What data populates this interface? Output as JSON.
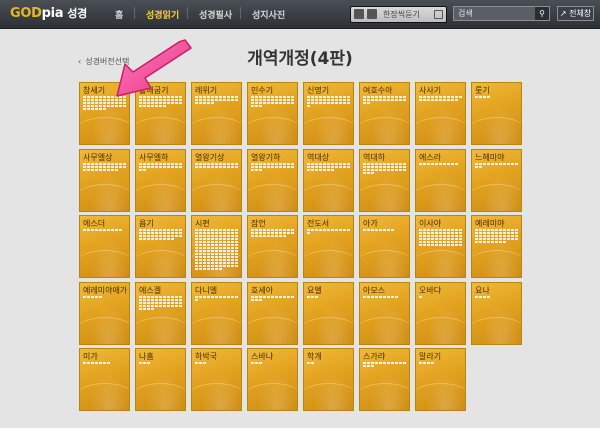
{
  "header": {
    "logo_go": "GOD",
    "logo_pia": "pia",
    "logo_sub": "성경",
    "nav": [
      "홈",
      "성경읽기",
      "성경필사",
      "성지사진"
    ],
    "active_nav_index": 1,
    "tts_label": "한장씩듣기",
    "search_placeholder": "검색",
    "fullscreen_label": "전체창"
  },
  "back_link": "성경버전선택",
  "page_title": "개역개정(4판)",
  "books": [
    {
      "name": "창세기",
      "chapters": 50
    },
    {
      "name": "출애굽기",
      "chapters": 40
    },
    {
      "name": "레위기",
      "chapters": 27
    },
    {
      "name": "민수기",
      "chapters": 36
    },
    {
      "name": "신명기",
      "chapters": 34
    },
    {
      "name": "여호수아",
      "chapters": 24
    },
    {
      "name": "사사기",
      "chapters": 21
    },
    {
      "name": "룻기",
      "chapters": 4
    },
    {
      "name": "사무엘상",
      "chapters": 31
    },
    {
      "name": "사무엘하",
      "chapters": 24
    },
    {
      "name": "열왕기상",
      "chapters": 22
    },
    {
      "name": "열왕기하",
      "chapters": 25
    },
    {
      "name": "역대상",
      "chapters": 29
    },
    {
      "name": "역대하",
      "chapters": 36
    },
    {
      "name": "에스라",
      "chapters": 10
    },
    {
      "name": "느헤미야",
      "chapters": 13
    },
    {
      "name": "에스더",
      "chapters": 10
    },
    {
      "name": "욥기",
      "chapters": 42
    },
    {
      "name": "시편",
      "chapters": 150
    },
    {
      "name": "잠언",
      "chapters": 31
    },
    {
      "name": "전도서",
      "chapters": 12
    },
    {
      "name": "아가",
      "chapters": 8
    },
    {
      "name": "이사야",
      "chapters": 66
    },
    {
      "name": "예레미야",
      "chapters": 52
    },
    {
      "name": "예레미야애가",
      "chapters": 5
    },
    {
      "name": "에스겔",
      "chapters": 48
    },
    {
      "name": "다니엘",
      "chapters": 12
    },
    {
      "name": "호세아",
      "chapters": 14
    },
    {
      "name": "요엘",
      "chapters": 3
    },
    {
      "name": "아모스",
      "chapters": 9
    },
    {
      "name": "오바댜",
      "chapters": 1
    },
    {
      "name": "요나",
      "chapters": 4
    },
    {
      "name": "미가",
      "chapters": 7
    },
    {
      "name": "나훔",
      "chapters": 3
    },
    {
      "name": "하박국",
      "chapters": 3
    },
    {
      "name": "스바냐",
      "chapters": 3
    },
    {
      "name": "학개",
      "chapters": 2
    },
    {
      "name": "스가랴",
      "chapters": 14
    },
    {
      "name": "말라기",
      "chapters": 4
    }
  ],
  "colors": {
    "topbar": "#2d3136",
    "nav_active": "#ffd23a",
    "book_tile": "#e2a21f",
    "arrow": "#f24a9a"
  }
}
